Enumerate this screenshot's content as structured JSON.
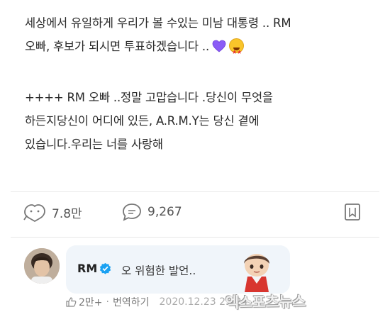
{
  "post": {
    "paragraph1": "세상에서 유일하게 우리가 볼 수있는 미남 대통령 .. RM\n오빠, 후보가 되시면 투표하겠습니다 ..",
    "paragraph2": "++++ RM 오빠 ..정말 고맙습니다 .당신이 무엇을\n하든지당신이 어디에 있든, A.R.M.Y는 당신 곁에\n있습니다.우리는 너를 사랑해"
  },
  "actions": {
    "like_count": "7.8만",
    "comment_count": "9,267"
  },
  "reply": {
    "author": "RM",
    "text": "오 위험한 발언..",
    "like_count": "2만+",
    "separator": "·",
    "translate_label": "번역하기",
    "date": "2020.12.23 23:24"
  },
  "watermark": "엑스포츠뉴스",
  "colors": {
    "accent": "#1aa1f2",
    "bubble": "#f0f5fa",
    "text": "#2a2a2a",
    "heart": "#8b5cf6"
  },
  "icons": [
    "purple-heart-emoji",
    "star-struck-emoji",
    "like-icon",
    "comment-icon",
    "bookmark-icon",
    "verified-badge-icon",
    "thumb-up-icon"
  ]
}
